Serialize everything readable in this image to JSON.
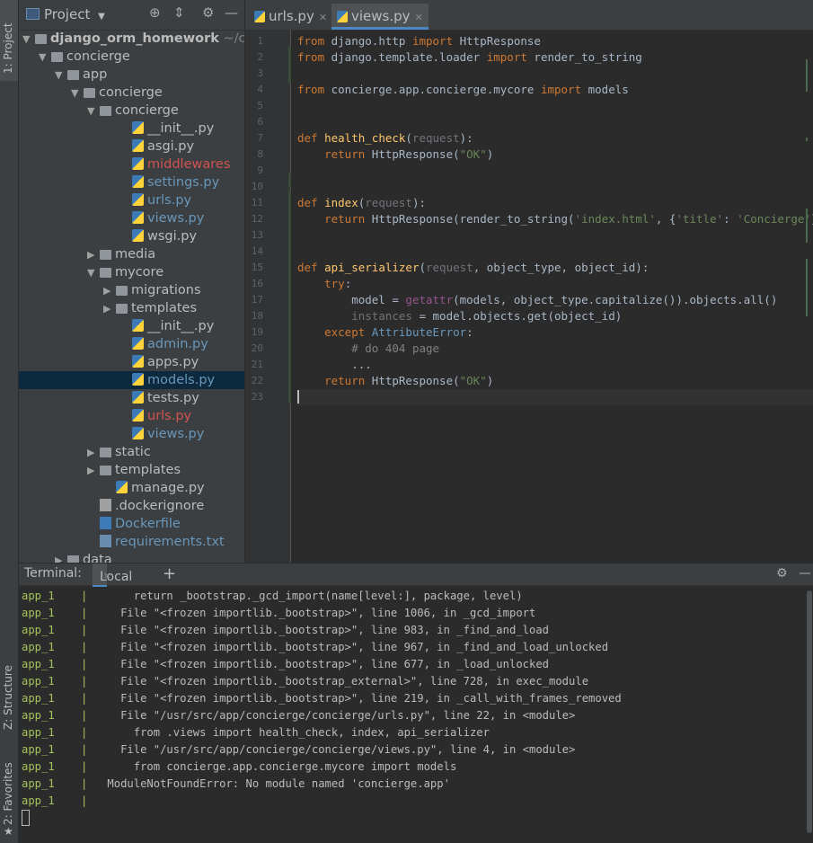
{
  "side_tabs": {
    "project": "1: Project",
    "structure": "Z: Structure",
    "favorites": "2: Favorites"
  },
  "project_panel": {
    "title": "Project",
    "tree": [
      {
        "label": "django_orm_homework",
        "suffix": "~/con",
        "arrow": "open",
        "icon": "folder",
        "color": "bold"
      },
      {
        "label": "concierge",
        "arrow": "open",
        "icon": "folder"
      },
      {
        "label": "app",
        "arrow": "open",
        "icon": "folder"
      },
      {
        "label": "concierge",
        "arrow": "open",
        "icon": "folder"
      },
      {
        "label": "concierge",
        "arrow": "open",
        "icon": "folder"
      },
      {
        "label": "__init__.py",
        "icon": "py"
      },
      {
        "label": "asgi.py",
        "icon": "py"
      },
      {
        "label": "middlewares",
        "icon": "py",
        "color": "red"
      },
      {
        "label": "settings.py",
        "icon": "py",
        "color": "blue"
      },
      {
        "label": "urls.py",
        "icon": "py",
        "color": "blue"
      },
      {
        "label": "views.py",
        "icon": "py",
        "color": "blue"
      },
      {
        "label": "wsgi.py",
        "icon": "py"
      },
      {
        "label": "media",
        "arrow": "closed",
        "icon": "folder"
      },
      {
        "label": "mycore",
        "arrow": "open",
        "icon": "folder"
      },
      {
        "label": "migrations",
        "arrow": "closed",
        "icon": "folder"
      },
      {
        "label": "templates",
        "arrow": "closed",
        "icon": "folder"
      },
      {
        "label": "__init__.py",
        "icon": "py"
      },
      {
        "label": "admin.py",
        "icon": "py",
        "color": "blue"
      },
      {
        "label": "apps.py",
        "icon": "py"
      },
      {
        "label": "models.py",
        "icon": "py",
        "color": "blue",
        "selected": true
      },
      {
        "label": "tests.py",
        "icon": "py"
      },
      {
        "label": "urls.py",
        "icon": "py",
        "color": "red"
      },
      {
        "label": "views.py",
        "icon": "py",
        "color": "blue"
      },
      {
        "label": "static",
        "arrow": "closed",
        "icon": "folder"
      },
      {
        "label": "templates",
        "arrow": "closed",
        "icon": "folder"
      },
      {
        "label": "manage.py",
        "icon": "py"
      },
      {
        "label": ".dockerignore",
        "icon": "file"
      },
      {
        "label": "Dockerfile",
        "icon": "docker",
        "color": "blue"
      },
      {
        "label": "requirements.txt",
        "icon": "req",
        "color": "blue"
      },
      {
        "label": "data",
        "arrow": "closed",
        "icon": "folder"
      }
    ]
  },
  "editor": {
    "tabs": [
      {
        "label": "urls.py",
        "active": false
      },
      {
        "label": "views.py",
        "active": true
      }
    ],
    "lines": [
      "<span class='k'>from</span> django.http <span class='k'>import</span> HttpResponse",
      "<span class='k'>from</span> django.template.loader <span class='k'>import</span> render_to_string",
      "",
      "<span class='k'>from</span> concierge.app.concierge.mycore <span class='k'>import</span> models",
      "",
      "",
      "<span class='k'>def</span> <span class='f'>health_check</span>(<span class='g'>request</span>):",
      "    <span class='k'>return</span> HttpResponse(<span class='s'>\"OK\"</span>)",
      "",
      "",
      "<span class='k'>def</span> <span class='f'>index</span>(<span class='g'>request</span>):",
      "    <span class='k'>return</span> HttpResponse(render_to_string(<span class='s'>'index.html'</span>, {<span class='s'>'title'</span>: <span class='s'>'Concierge'</span>}))",
      "",
      "",
      "<span class='k'>def</span> <span class='f'>api_serializer</span>(<span class='g'>request</span>, object_type, object_id):",
      "    <span class='k'>try</span>:",
      "        model = <span class='p'>getattr</span>(models, object_type.capitalize()).objects.all()",
      "        <span class='g'>instances</span> = model.objects.get(object_id)",
      "    <span class='k'>except</span> <span class='n'>AttributeError</span>:",
      "        <span class='cm'># do 404 page</span>",
      "        ...",
      "    <span class='k'>return</span> HttpResponse(<span class='s'>\"OK\"</span>)",
      ""
    ]
  },
  "terminal": {
    "title": "Terminal:",
    "tab": "Local",
    "service": "app_1",
    "lines": [
      "      return _bootstrap._gcd_import(name[level:], package, level)",
      "    File \"<frozen importlib._bootstrap>\", line 1006, in _gcd_import",
      "    File \"<frozen importlib._bootstrap>\", line 983, in _find_and_load",
      "    File \"<frozen importlib._bootstrap>\", line 967, in _find_and_load_unlocked",
      "    File \"<frozen importlib._bootstrap>\", line 677, in _load_unlocked",
      "    File \"<frozen importlib._bootstrap_external>\", line 728, in exec_module",
      "    File \"<frozen importlib._bootstrap>\", line 219, in _call_with_frames_removed",
      "    File \"/usr/src/app/concierge/concierge/urls.py\", line 22, in <module>",
      "      from .views import health_check, index, api_serializer",
      "    File \"/usr/src/app/concierge/concierge/views.py\", line 4, in <module>",
      "      from concierge.app.concierge.mycore import models",
      "  ModuleNotFoundError: No module named 'concierge.app'",
      ""
    ]
  }
}
